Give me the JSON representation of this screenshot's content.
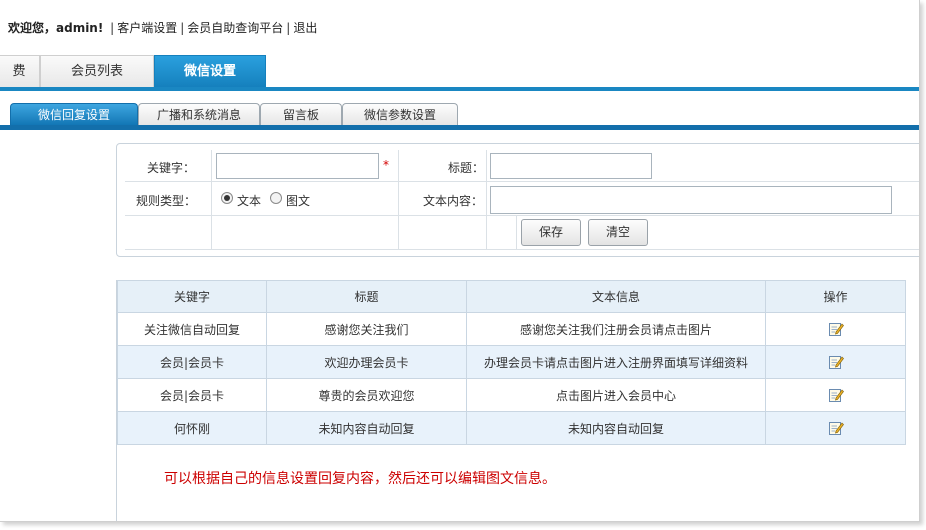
{
  "topbar": {
    "welcome": "欢迎您，admin!",
    "links": [
      "客户端设置",
      "会员自助查询平台",
      "退出"
    ],
    "separator": "|"
  },
  "mainnav": {
    "tabs": [
      {
        "label": "费",
        "active": false
      },
      {
        "label": "会员列表",
        "active": false
      },
      {
        "label": "微信设置",
        "active": true
      }
    ]
  },
  "subnav": {
    "tabs": [
      {
        "label": "微信回复设置",
        "active": true
      },
      {
        "label": "广播和系统消息",
        "active": false
      },
      {
        "label": "留言板",
        "active": false
      },
      {
        "label": "微信参数设置",
        "active": false
      }
    ]
  },
  "form": {
    "keyword_label": "关键字：",
    "keyword_value": "",
    "required_mark": "*",
    "title_label": "标题：",
    "title_value": "",
    "rule_type_label": "规则类型：",
    "rule_options": [
      "文本",
      "图文"
    ],
    "rule_selected": "文本",
    "content_label": "文本内容：",
    "content_value": "",
    "save_label": "保存",
    "clear_label": "清空"
  },
  "table": {
    "headers": [
      "关键字",
      "标题",
      "文本信息",
      "操作"
    ],
    "rows": [
      {
        "keyword": "关注微信自动回复",
        "title": "感谢您关注我们",
        "text": "感谢您关注我们注册会员请点击图片"
      },
      {
        "keyword": "会员|会员卡",
        "title": "欢迎办理会员卡",
        "text": "办理会员卡请点击图片进入注册界面填写详细资料"
      },
      {
        "keyword": "会员|会员卡",
        "title": "尊贵的会员欢迎您",
        "text": "点击图片进入会员中心"
      },
      {
        "keyword": "何怀刚",
        "title": "未知内容自动回复",
        "text": "未知内容自动回复"
      }
    ],
    "action_icon": "edit-icon"
  },
  "note": "可以根据自己的信息设置回复内容，然后还可以编辑图文信息。",
  "colors": {
    "accent": "#1a87c2",
    "note": "#cc0000",
    "row_alt": "#e8f2fb"
  }
}
